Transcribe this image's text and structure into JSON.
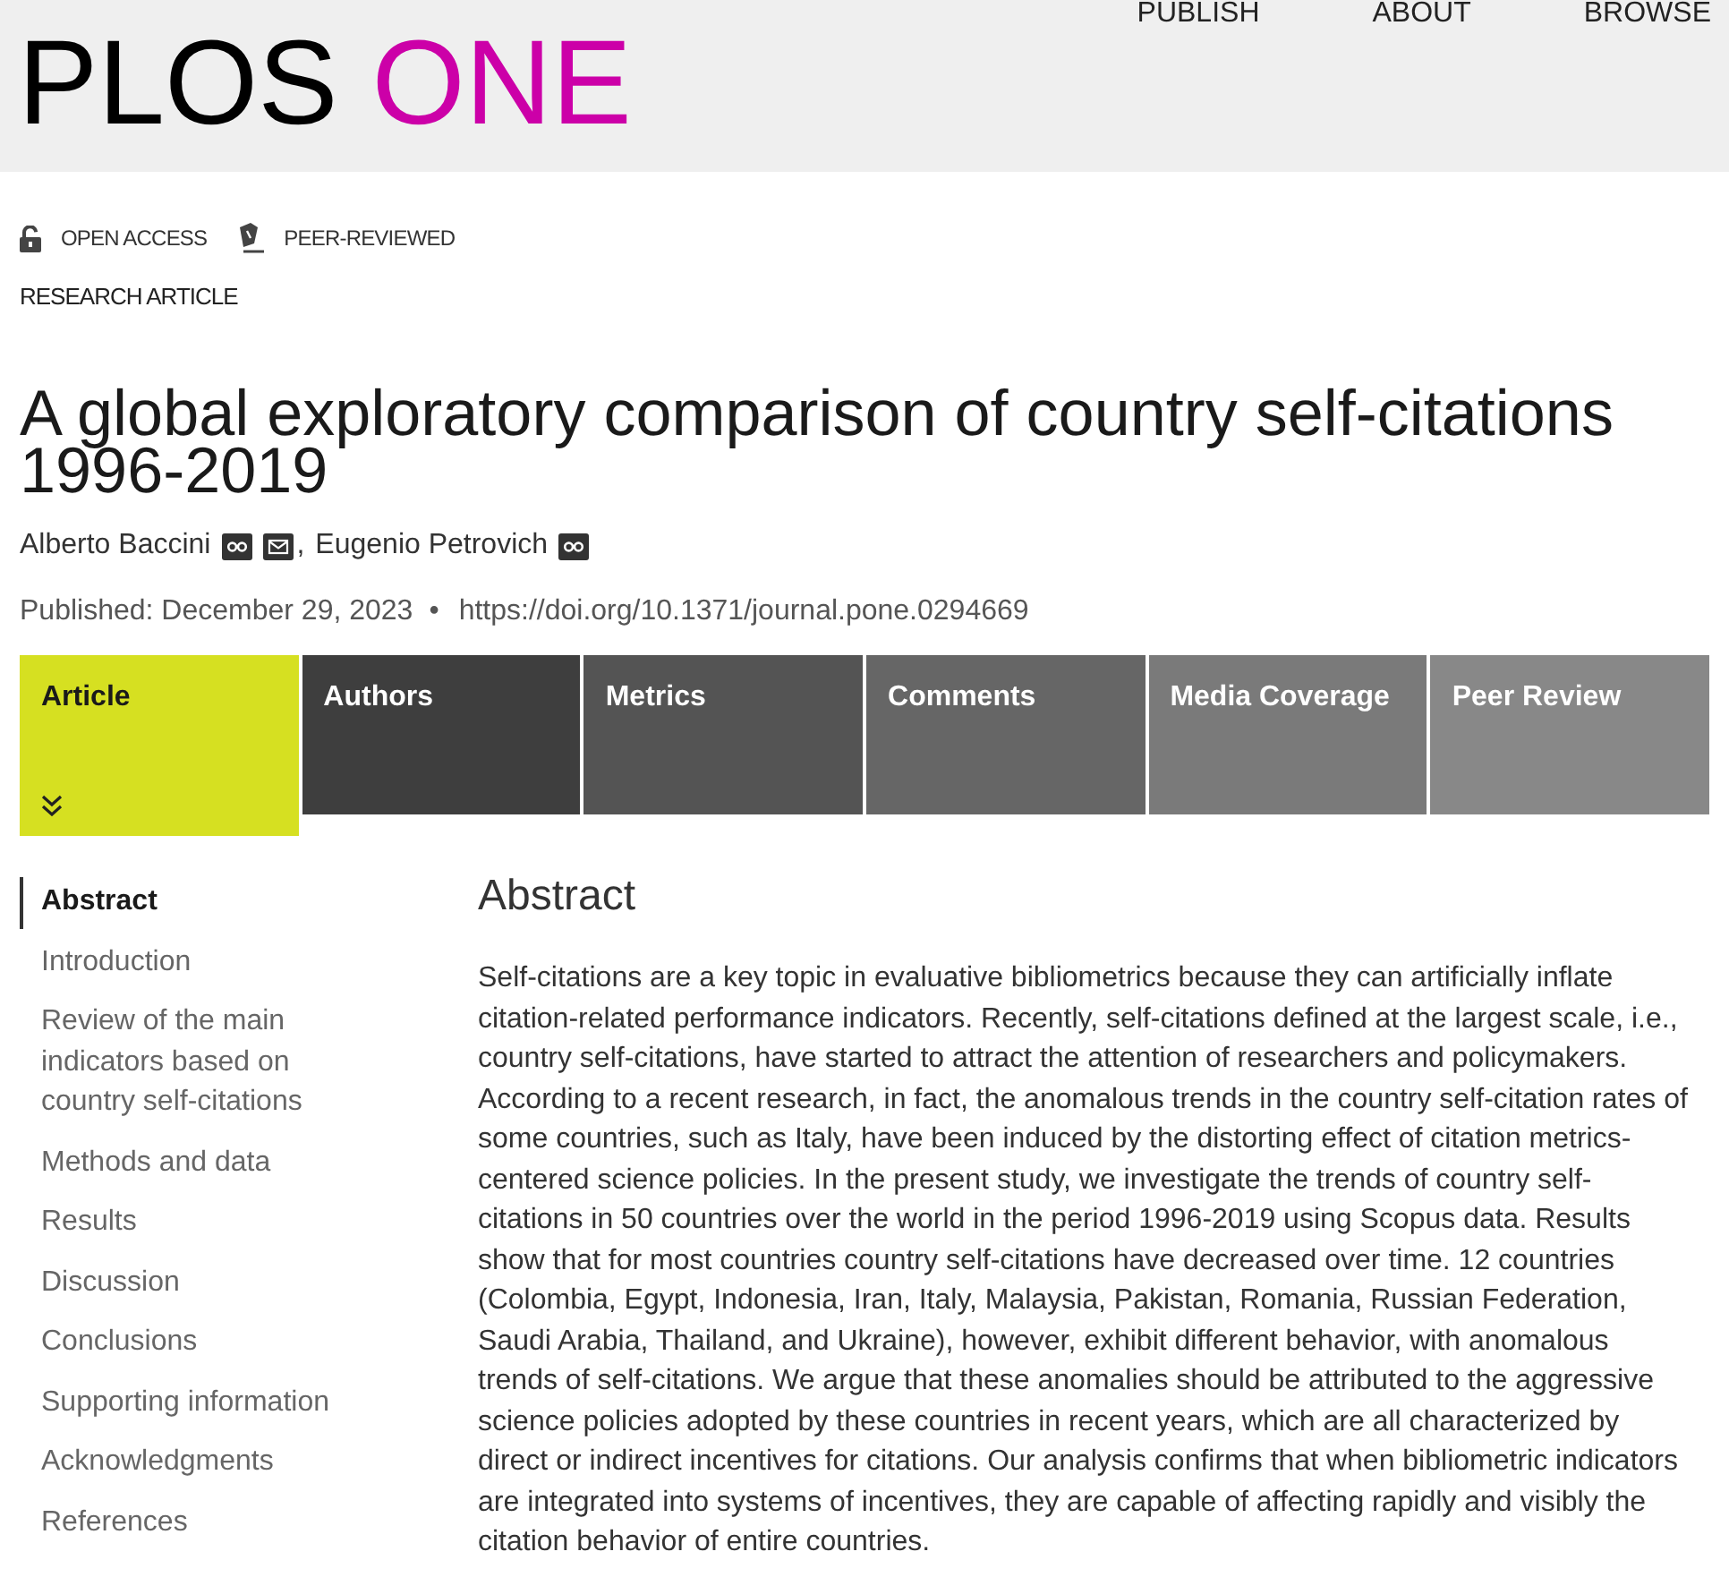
{
  "header": {
    "logo": {
      "primary": "PLOS",
      "accent": "ONE"
    },
    "nav": [
      "PUBLISH",
      "ABOUT",
      "BROWSE"
    ]
  },
  "badges": [
    {
      "kind": "open-access",
      "label": "OPEN ACCESS"
    },
    {
      "kind": "peer-reviewed",
      "label": "PEER-REVIEWED"
    }
  ],
  "article_type": "RESEARCH ARTICLE",
  "title": "A global exploratory comparison of country self-citations 1996-2019",
  "authors": {
    "separator": ",",
    "list": [
      {
        "name": "Alberto Baccini",
        "badge": true,
        "email": true
      },
      {
        "name": "Eugenio Petrovich",
        "badge": true,
        "email": false
      }
    ]
  },
  "publication": {
    "date": "Published: December 29, 2023",
    "bullet": "•",
    "doi": "https://doi.org/10.1371/journal.pone.0294669"
  },
  "tabs": [
    {
      "label": "Article",
      "selected": true
    },
    {
      "label": "Authors",
      "selected": false
    },
    {
      "label": "Metrics",
      "selected": false
    },
    {
      "label": "Comments",
      "selected": false
    },
    {
      "label": "Media Coverage",
      "selected": false
    },
    {
      "label": "Peer Review",
      "selected": false
    }
  ],
  "sidebar": {
    "items": [
      {
        "label": "Abstract",
        "selected": true
      },
      {
        "label": "Introduction",
        "selected": false
      },
      {
        "label": "Review of the main indicators based on country self-citations",
        "selected": false
      },
      {
        "label": "Methods and data",
        "selected": false
      },
      {
        "label": "Results",
        "selected": false
      },
      {
        "label": "Discussion",
        "selected": false
      },
      {
        "label": "Conclusions",
        "selected": false
      },
      {
        "label": "Supporting information",
        "selected": false
      },
      {
        "label": "Acknowledgments",
        "selected": false
      },
      {
        "label": "References",
        "selected": false
      }
    ]
  },
  "abstract": {
    "heading": "Abstract",
    "text": "Self-citations are a key topic in evaluative bibliometrics because they can artificially inflate citation-related performance indicators. Recently, self-citations defined at the largest scale, i.e., country self-citations, have started to attract the attention of researchers and policymakers. According to a recent research, in fact, the anomalous trends in the country self-citation rates of some countries, such as Italy, have been induced by the distorting effect of citation metrics-centered science policies. In the present study, we investigate the trends of country self-citations in 50 countries over the world in the period 1996-2019 using Scopus data. Results show that for most countries country self-citations have decreased over time. 12 countries (Colombia, Egypt, Indonesia, Iran, Italy, Malaysia, Pakistan, Romania, Russian Federation, Saudi Arabia, Thailand, and Ukraine), however, exhibit different behavior, with anomalous trends of self-citations. We argue that these anomalies should be attributed to the aggressive science policies adopted by these countries in recent years, which are all characterized by direct or indirect incentives for citations. Our analysis confirms that when bibliometric indicators are integrated into systems of incentives, they are capable of affecting rapidly and visibly the citation behavior of entire countries."
  }
}
